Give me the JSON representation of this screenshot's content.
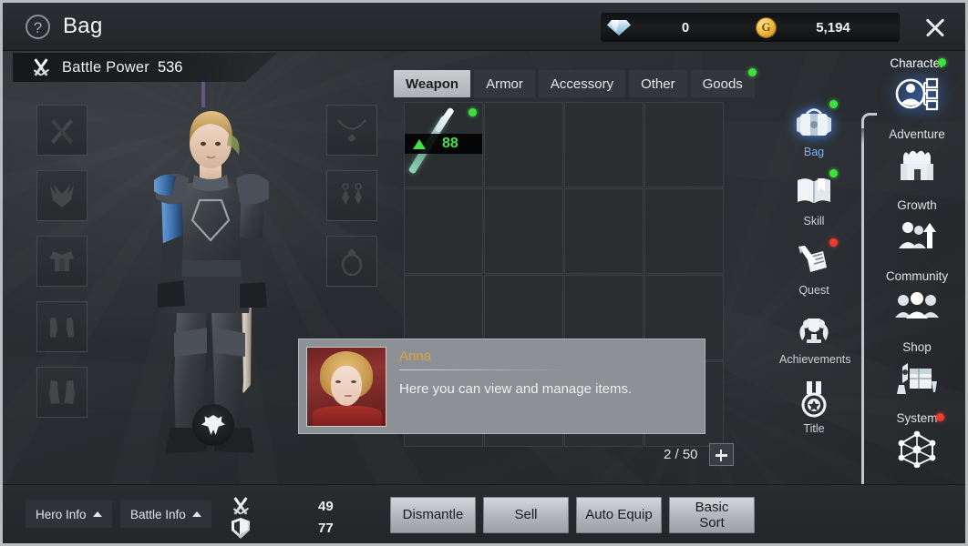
{
  "window": {
    "title": "Bag",
    "help_icon": "question-mark-icon",
    "close_icon": "close-icon"
  },
  "currency": [
    {
      "icon": "diamond-icon",
      "name": "Diamond",
      "value": "0"
    },
    {
      "icon": "gold-coin-icon",
      "name": "Gold",
      "value": "5,194",
      "glyph": "G"
    }
  ],
  "battle_power": {
    "icon": "crossed-swords-icon",
    "label": "Battle Power",
    "value": "536"
  },
  "equipment_slots": [
    {
      "name": "weapon-slot",
      "icon": "crossed-weapons-icon"
    },
    {
      "name": "helmet-slot",
      "icon": "helmet-icon"
    },
    {
      "name": "chest-slot",
      "icon": "chest-armor-icon"
    },
    {
      "name": "gloves-slot",
      "icon": "gloves-icon"
    },
    {
      "name": "boots-slot",
      "icon": "boots-icon"
    }
  ],
  "accessory_slots": [
    {
      "name": "necklace-slot",
      "icon": "necklace-icon"
    },
    {
      "name": "earring-slot",
      "icon": "earrings-icon"
    },
    {
      "name": "ring-slot",
      "icon": "ring-icon"
    }
  ],
  "tabs": [
    {
      "label": "Weapon",
      "active": true,
      "badge": null
    },
    {
      "label": "Armor",
      "active": false,
      "badge": null
    },
    {
      "label": "Accessory",
      "active": false,
      "badge": null
    },
    {
      "label": "Other",
      "active": false,
      "badge": null
    },
    {
      "label": "Goods",
      "active": false,
      "badge": "green"
    }
  ],
  "inventory": {
    "slots_used": "2",
    "slots_total": "50",
    "counter_text": "2 / 50",
    "add_slot_icon": "plus-icon",
    "columns": 4,
    "rows": 4,
    "items": [
      {
        "index": 0,
        "name": "equipped-weapon",
        "level": "88",
        "upgrade_icon": "green-triangle-icon",
        "badge": "green",
        "accent": "#46e24c"
      }
    ]
  },
  "dialog": {
    "speaker": "Anna",
    "text": "Here you can view and manage items.",
    "portrait": "anna-portrait"
  },
  "bottom_bar": {
    "hero_info": {
      "label": "Hero Info",
      "caret": "caret-up-icon"
    },
    "battle_info": {
      "label": "Battle Info",
      "caret": "caret-up-icon"
    },
    "stats": [
      {
        "icon": "attack-swords-icon",
        "name": "attack",
        "value": "49"
      },
      {
        "icon": "defense-shield-icon",
        "name": "defense",
        "value": "77"
      }
    ],
    "actions": [
      {
        "label": "Dismantle",
        "name": "dismantle-button"
      },
      {
        "label": "Sell",
        "name": "sell-button"
      },
      {
        "label": "Auto Equip",
        "name": "auto-equip-button"
      },
      {
        "label": "Basic\nSort",
        "name": "basic-sort-button",
        "line1": "Basic",
        "line2": "Sort"
      }
    ]
  },
  "side_menu": [
    {
      "label": "Bag",
      "icon": "bag-icon",
      "active": true,
      "badge": "green"
    },
    {
      "label": "Skill",
      "icon": "book-icon",
      "active": false,
      "badge": "green"
    },
    {
      "label": "Quest",
      "icon": "quest-scroll-icon",
      "active": false,
      "badge": "red"
    },
    {
      "label": "Achievements",
      "icon": "trophy-wreath-icon",
      "active": false,
      "badge": null
    },
    {
      "label": "Title",
      "icon": "medal-icon",
      "active": false,
      "badge": null
    }
  ],
  "main_menu": [
    {
      "label": "Character",
      "icon": "character-icon",
      "active": true,
      "badge": "green"
    },
    {
      "label": "Adventure",
      "icon": "adventure-icon",
      "active": false,
      "badge": null
    },
    {
      "label": "Growth",
      "icon": "growth-icon",
      "active": false,
      "badge": null
    },
    {
      "label": "Community",
      "icon": "community-icon",
      "active": false,
      "badge": null
    },
    {
      "label": "Shop",
      "icon": "shop-icon",
      "active": false,
      "badge": null
    },
    {
      "label": "System",
      "icon": "system-node-icon",
      "active": false,
      "badge": "red"
    }
  ],
  "colors": {
    "accent_blue": "#7fb3f0",
    "badge_green": "#3ee03e",
    "badge_red": "#f03a2e",
    "speaker_gold": "#d9a43c",
    "item_green": "#46e24c",
    "panel_bg": "#2b2e31"
  }
}
